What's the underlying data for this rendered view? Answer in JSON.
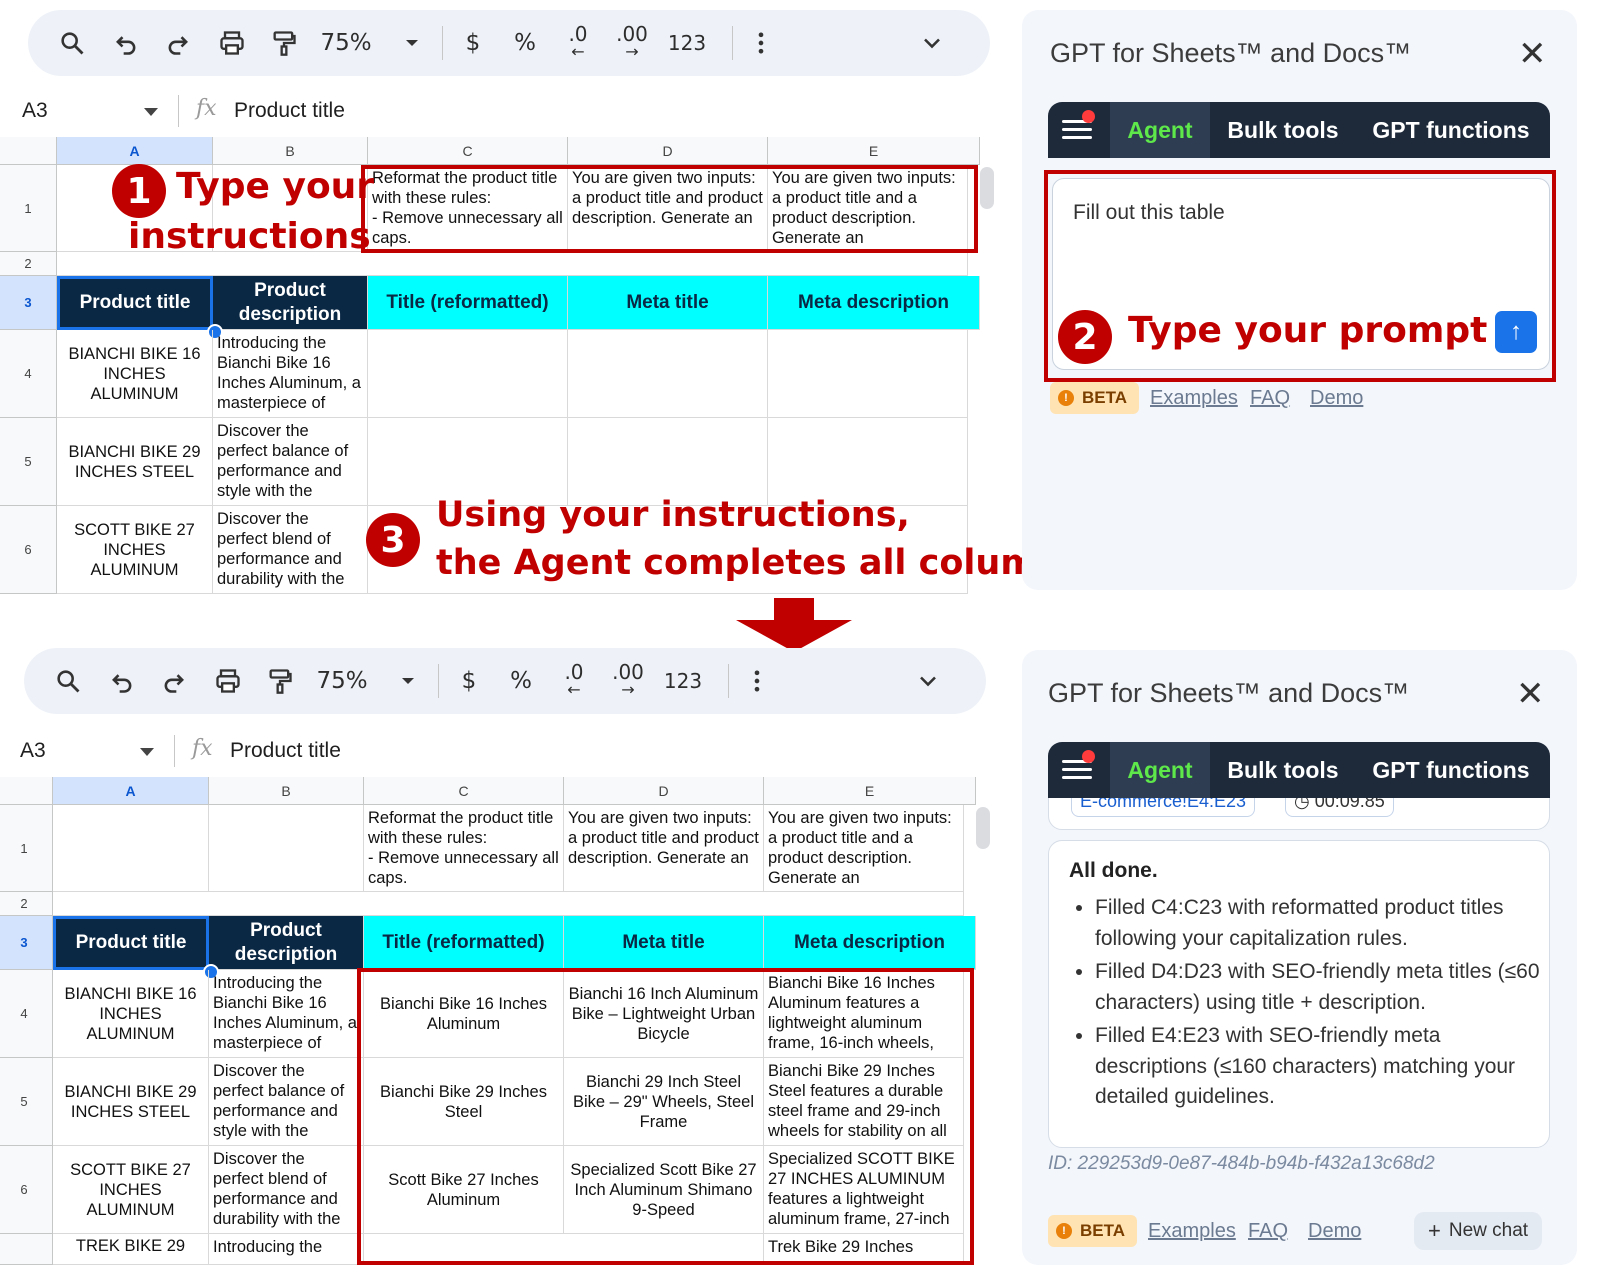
{
  "toolbar": {
    "zoom": "75%",
    "currency": "$",
    "percent": "%",
    "dec_decrease": ".0",
    "dec_increase": ".00",
    "format_123": "123",
    "icons": [
      "search-icon",
      "undo-icon",
      "redo-icon",
      "print-icon",
      "paint-format-icon",
      "zoom-dropdown-icon",
      "more-vert-icon",
      "collapse-chevron-icon"
    ]
  },
  "formula_bar": {
    "name_box": "A3",
    "fx": "fx",
    "value": "Product title"
  },
  "columns": [
    "A",
    "B",
    "C",
    "D",
    "E"
  ],
  "rows": [
    "1",
    "2",
    "3",
    "4",
    "5",
    "6"
  ],
  "row1": {
    "c": "Reformat the product title with these rules:\n- Remove unnecessary all caps.",
    "d": "You are given two inputs: a product title and product description. Generate an",
    "e": "You are given two inputs: a product title and a product description. Generate an"
  },
  "headers": [
    "Product title",
    "Product description",
    "Title (reformatted)",
    "Meta title",
    "Meta description"
  ],
  "data_rows": [
    {
      "title": "BIANCHI BIKE 16 INCHES ALUMINUM",
      "desc": "Introducing the Bianchi Bike 16 Inches Aluminum, a masterpiece of",
      "reformatted": "Bianchi Bike 16 Inches Aluminum",
      "meta_title": "Bianchi 16 Inch Aluminum Bike – Lightweight Urban Bicycle",
      "meta_desc": "Bianchi Bike 16 Inches Aluminum features a lightweight aluminum frame, 16-inch wheels,"
    },
    {
      "title": "BIANCHI BIKE 29 INCHES STEEL",
      "desc": "Discover the perfect balance of performance and style with the",
      "reformatted": "Bianchi Bike 29 Inches Steel",
      "meta_title": "Bianchi 29 Inch Steel Bike – 29\" Wheels, Steel Frame",
      "meta_desc": "Bianchi Bike 29 Inches Steel features a durable steel frame and 29-inch wheels for stability on all"
    },
    {
      "title": "SCOTT BIKE 27 INCHES ALUMINUM",
      "desc": "Discover the perfect blend of performance and durability with the",
      "reformatted": "Scott Bike 27 Inches Aluminum",
      "meta_title": "Specialized Scott Bike 27 Inch Aluminum Shimano 9-Speed",
      "meta_desc": "Specialized SCOTT BIKE 27 INCHES ALUMINUM features a lightweight aluminum frame, 27-inch"
    }
  ],
  "row7_partial": {
    "title": "TREK BIKE 29",
    "desc": "Introducing the",
    "meta_desc": "Trek Bike 29 Inches"
  },
  "annotations": {
    "step1_num": "1",
    "step1_text": "Type your instructions",
    "step1_line1": "Type your",
    "step1_line2": "instructions",
    "step2_num": "2",
    "step2_text": "Type your prompt",
    "step3_num": "3",
    "step3_line1": "Using your instructions,",
    "step3_line2": "the Agent completes all columns"
  },
  "sidebar": {
    "title": "GPT for Sheets™ and Docs™",
    "close": "✕",
    "tabs": [
      "Agent",
      "Bulk tools",
      "GPT functions"
    ],
    "prompt_text": "Fill out this table",
    "send_icon": "arrow-up-icon",
    "beta": "BETA",
    "links": [
      "Examples",
      "FAQ",
      "Demo"
    ],
    "partial_chip_1": "E-commerce!E4:E23",
    "partial_chip_2": "00:09.85",
    "done_title": "All done.",
    "done_items": [
      "Filled C4:C23 with reformatted product titles following your capitalization rules.",
      "Filled D4:D23 with SEO-friendly meta titles (≤60 characters) using title + description.",
      "Filled E4:E23 with SEO-friendly meta descriptions (≤160 characters) matching your detailed guidelines."
    ],
    "id_text": "ID: 229253d9-0e87-484b-b94b-f432a13c68d2",
    "new_chat": "New chat"
  },
  "colors": {
    "header_dark": "#0a2744",
    "header_cyan": "#00ffff",
    "annotation_red": "#c00000",
    "agent_green": "#5ee84a",
    "accent_blue": "#1a73e8"
  }
}
